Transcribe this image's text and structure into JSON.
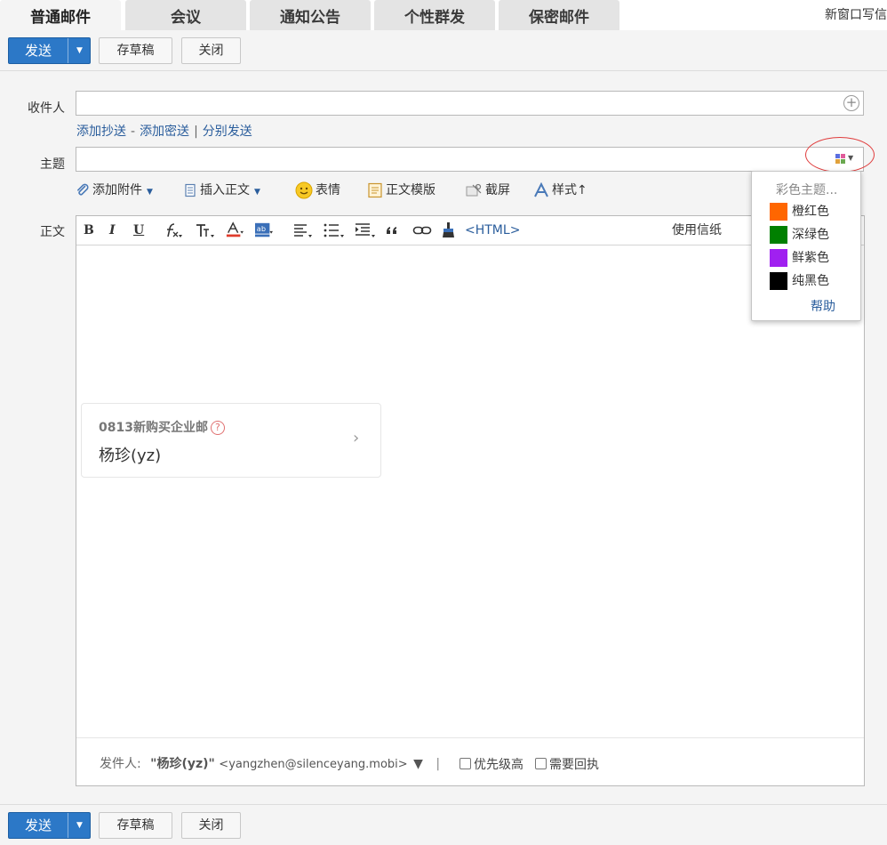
{
  "tabs": [
    {
      "label": "普通邮件"
    },
    {
      "label": "会议"
    },
    {
      "label": "通知公告"
    },
    {
      "label": "个性群发"
    },
    {
      "label": "保密邮件"
    }
  ],
  "new_window": "新窗口写信",
  "toolbar": {
    "send_label": "发送",
    "draft_label": "存草稿",
    "close_label": "关闭"
  },
  "compose": {
    "to_label": "收件人",
    "cc_link": "添加抄送",
    "cc_sep": "-",
    "bcc_link": "添加密送",
    "bar_sep": "|",
    "separate_link": "分别发送",
    "subject_label": "主题",
    "body_label": "正文"
  },
  "attach_toolbar": {
    "attach": "添加附件",
    "insert_body": "插入正文",
    "emoji": "表情",
    "template": "正文模版",
    "screenshot": "截屏",
    "style": "样式↑"
  },
  "format_bar": {
    "bold": "B",
    "italic": "I",
    "underline": "U",
    "html": "<HTML>",
    "stationery": "使用信纸"
  },
  "signature": {
    "company": "0813新购买企业邮",
    "help_mark": "?",
    "name": "杨珍(yz)",
    "chevron": "›"
  },
  "footer": {
    "sender_label": "发件人:",
    "sender_name": "\"杨珍(yz)\"",
    "sender_email": "<yangzhen@silenceyang.mobi>",
    "dropdown": "▼",
    "divider": "|",
    "priority": "优先级高",
    "receipt": "需要回执"
  },
  "theme_menu": {
    "title": "彩色主题...",
    "items": [
      {
        "label": "橙红色",
        "color": "#ff6600"
      },
      {
        "label": "深绿色",
        "color": "#008000"
      },
      {
        "label": "鲜紫色",
        "color": "#a020f0"
      },
      {
        "label": "纯黑色",
        "color": "#000000"
      }
    ],
    "help": "帮助"
  },
  "colors": {
    "accent": "#2c78c7",
    "link": "#2a5d9c",
    "highlight_circle": "#e03d3d"
  }
}
